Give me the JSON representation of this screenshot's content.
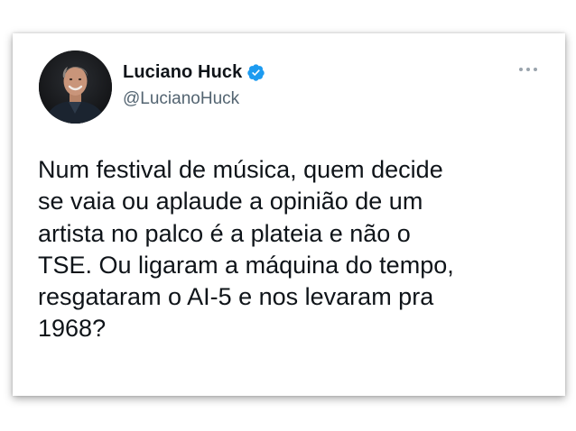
{
  "tweet": {
    "author": {
      "display_name": "Luciano Huck",
      "handle": "@LucianoHuck",
      "verified": true,
      "avatar_icon": "profile-photo"
    },
    "more_icon": "more-options-icon",
    "text": "Num festival de música, quem decide\nse vaia ou aplaude a opinião de um\nartista no palco é a plateia e não o\nTSE. Ou ligaram a máquina do tempo,\nresgataram o AI-5 e nos levaram pra\n1968?"
  },
  "colors": {
    "text_primary": "#0f1419",
    "text_secondary": "#536471",
    "verified_blue": "#1d9bf0",
    "card_background": "#ffffff"
  }
}
